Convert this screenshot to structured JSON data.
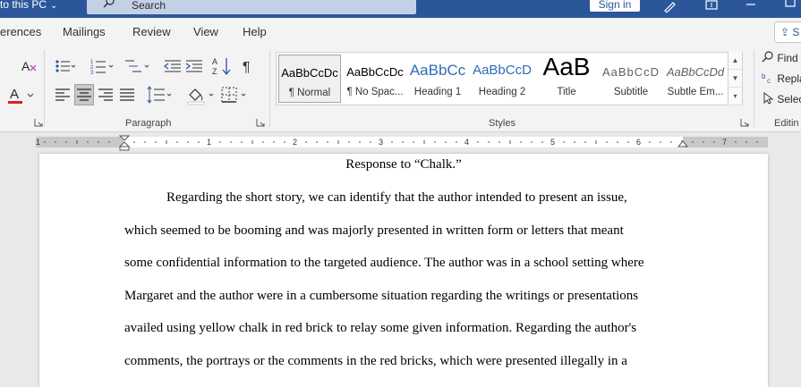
{
  "titlebar": {
    "doc_location": "to this PC",
    "search_placeholder": "Search",
    "signin_label": "Sign in"
  },
  "tabs": [
    {
      "label": "erences"
    },
    {
      "label": "Mailings"
    },
    {
      "label": "Review"
    },
    {
      "label": "View"
    },
    {
      "label": "Help"
    }
  ],
  "share_label": "S",
  "ribbon": {
    "paragraph_label": "Paragraph",
    "styles_label": "Styles",
    "editing_label": "Editin",
    "font_color_hex": "#e02020",
    "styles": [
      {
        "sample": "AaBbCcDc",
        "name": "¶ Normal"
      },
      {
        "sample": "AaBbCcDc",
        "name": "¶ No Spac..."
      },
      {
        "sample": "AaBbCc",
        "name": "Heading 1"
      },
      {
        "sample": "AaBbCcD",
        "name": "Heading 2"
      },
      {
        "sample": "AaB",
        "name": "Title"
      },
      {
        "sample": "AaBbCcD",
        "name": "Subtitle"
      },
      {
        "sample": "AaBbCcDd",
        "name": "Subtle Em..."
      }
    ],
    "editing": {
      "find": "Find",
      "replace": "Repla",
      "select": "Selec"
    }
  },
  "ruler_numbers": [
    "1",
    "1",
    "2",
    "3",
    "4",
    "5",
    "6",
    "7"
  ],
  "document": {
    "title": "Response to “Chalk.”",
    "lines": [
      "Regarding the short story, we can identify that the author intended to present an issue,",
      "which seemed to be booming and was majorly presented in written form or letters that meant",
      "some confidential information to the targeted audience. The author was in a school setting where",
      "Margaret and the author were in a cumbersome situation regarding the writings or presentations",
      "availed using yellow chalk in red brick to relay some given information. Regarding the author's",
      "comments, the portrays or the comments in the red bricks, which were presented illegally in a"
    ]
  }
}
